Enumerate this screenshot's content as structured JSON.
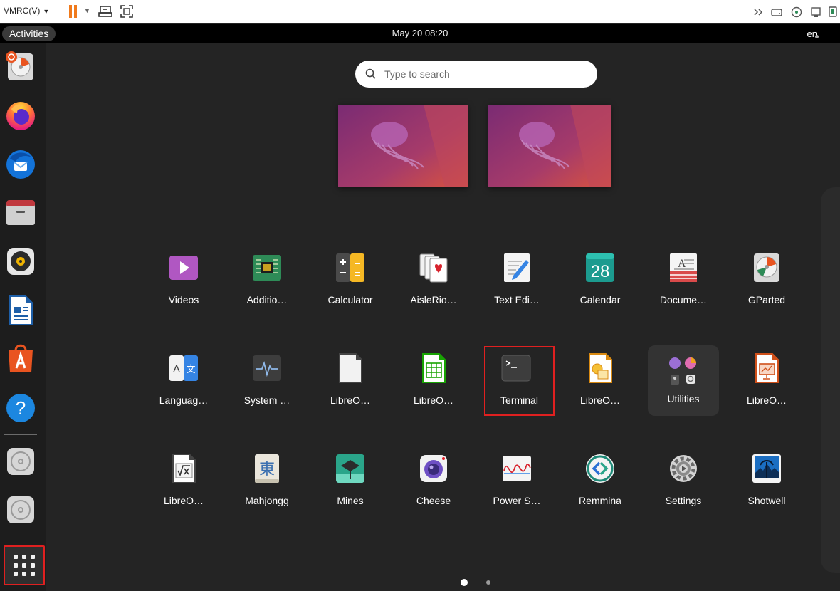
{
  "vmrc": {
    "menu_label": "VMRC(V)"
  },
  "topbar": {
    "activities": "Activities",
    "clock": "May 20  08:20",
    "lang": "en"
  },
  "search": {
    "placeholder": "Type to search"
  },
  "dock": {
    "items": [
      "gparted-icon",
      "firefox-icon",
      "thunderbird-icon",
      "files-icon",
      "rhythmbox-icon",
      "libreoffice-writer-icon",
      "app-center-icon",
      "help-icon",
      "disc-icon",
      "disc-icon"
    ]
  },
  "apps": [
    {
      "label": "Videos",
      "icon": "videos-icon"
    },
    {
      "label": "Additio…",
      "icon": "additional-drivers-icon"
    },
    {
      "label": "Calculator",
      "icon": "calculator-icon"
    },
    {
      "label": "AisleRio…",
      "icon": "cards-icon"
    },
    {
      "label": "Text Edi…",
      "icon": "text-editor-icon"
    },
    {
      "label": "Calendar",
      "icon": "calendar-icon",
      "day": "28"
    },
    {
      "label": "Docume…",
      "icon": "document-viewer-icon"
    },
    {
      "label": "GParted",
      "icon": "gparted-icon"
    },
    {
      "label": "Languag…",
      "icon": "language-icon"
    },
    {
      "label": "System …",
      "icon": "system-monitor-icon"
    },
    {
      "label": "LibreO…",
      "icon": "libreoffice-icon"
    },
    {
      "label": "LibreO…",
      "icon": "libreoffice-calc-icon"
    },
    {
      "label": "Terminal",
      "icon": "terminal-icon"
    },
    {
      "label": "LibreO…",
      "icon": "libreoffice-draw-icon"
    },
    {
      "label": "Utilities",
      "icon": "utilities-folder-icon"
    },
    {
      "label": "LibreO…",
      "icon": "libreoffice-impress-icon"
    },
    {
      "label": "LibreO…",
      "icon": "libreoffice-math-icon"
    },
    {
      "label": "Mahjongg",
      "icon": "mahjongg-icon",
      "glyph": "東"
    },
    {
      "label": "Mines",
      "icon": "mines-icon"
    },
    {
      "label": "Cheese",
      "icon": "cheese-icon"
    },
    {
      "label": "Power S…",
      "icon": "power-statistics-icon"
    },
    {
      "label": "Remmina",
      "icon": "remmina-icon"
    },
    {
      "label": "Settings",
      "icon": "settings-icon"
    },
    {
      "label": "Shotwell",
      "icon": "shotwell-icon"
    }
  ],
  "pages": {
    "current": 1,
    "total": 2
  },
  "colors": {
    "accent_orange": "#f07a1c",
    "highlight_red": "#e02020",
    "ubuntu_orange": "#e95420"
  }
}
